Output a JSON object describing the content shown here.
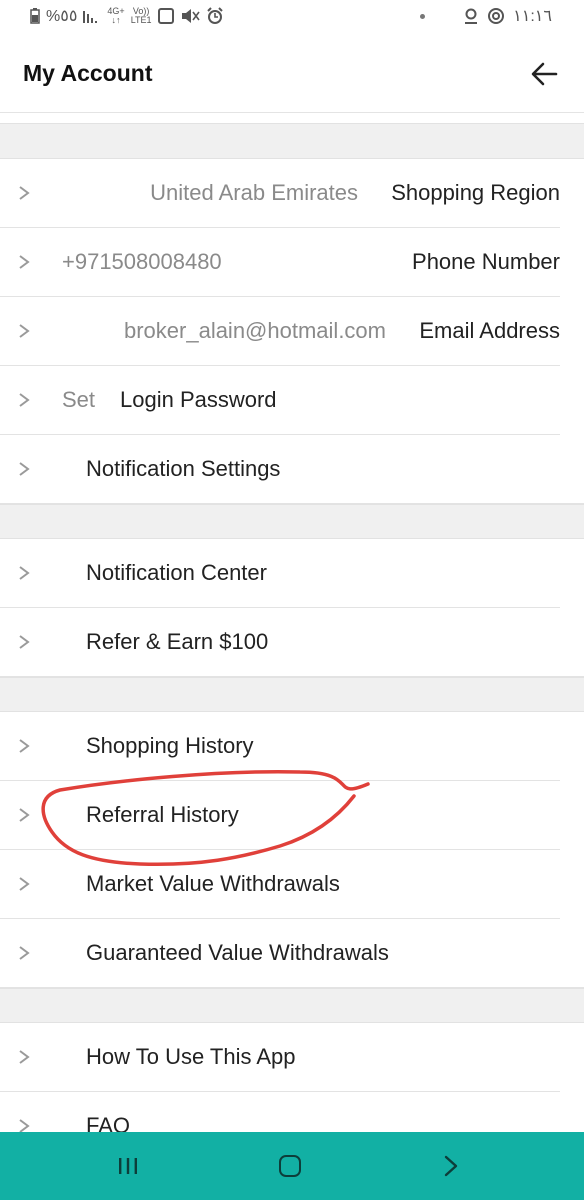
{
  "status_bar": {
    "battery_text": "%٥٥",
    "network": "4G+",
    "volte": "Vo))",
    "lte": "LTE1",
    "time": "١١:١٦"
  },
  "header": {
    "title": "My Account"
  },
  "account_rows": [
    {
      "label": "Shopping Region",
      "value": "United Arab Emirates"
    },
    {
      "label": "Phone Number",
      "value": "+971508008480"
    },
    {
      "label": "Email Address",
      "value": "broker_alain@hotmail.com"
    },
    {
      "label": "Login Password",
      "value": "Set"
    },
    {
      "label": "Notification Settings"
    }
  ],
  "section2": [
    "Notification Center",
    "Refer & Earn $100"
  ],
  "section3": [
    "Shopping History",
    "Referral History",
    "Market Value Withdrawals",
    "Guaranteed Value Withdrawals"
  ],
  "section4": [
    "How To Use This App",
    "FAQ"
  ],
  "colors": {
    "nav_bar": "#12b0a4",
    "annotation": "#e0403a",
    "section_gap": "#f0f0f0"
  },
  "icons": {
    "back": "arrow-left-icon",
    "row": "chevron-right-icon",
    "nav": [
      "recent-apps-icon",
      "home-icon",
      "back-chevron-icon"
    ]
  }
}
